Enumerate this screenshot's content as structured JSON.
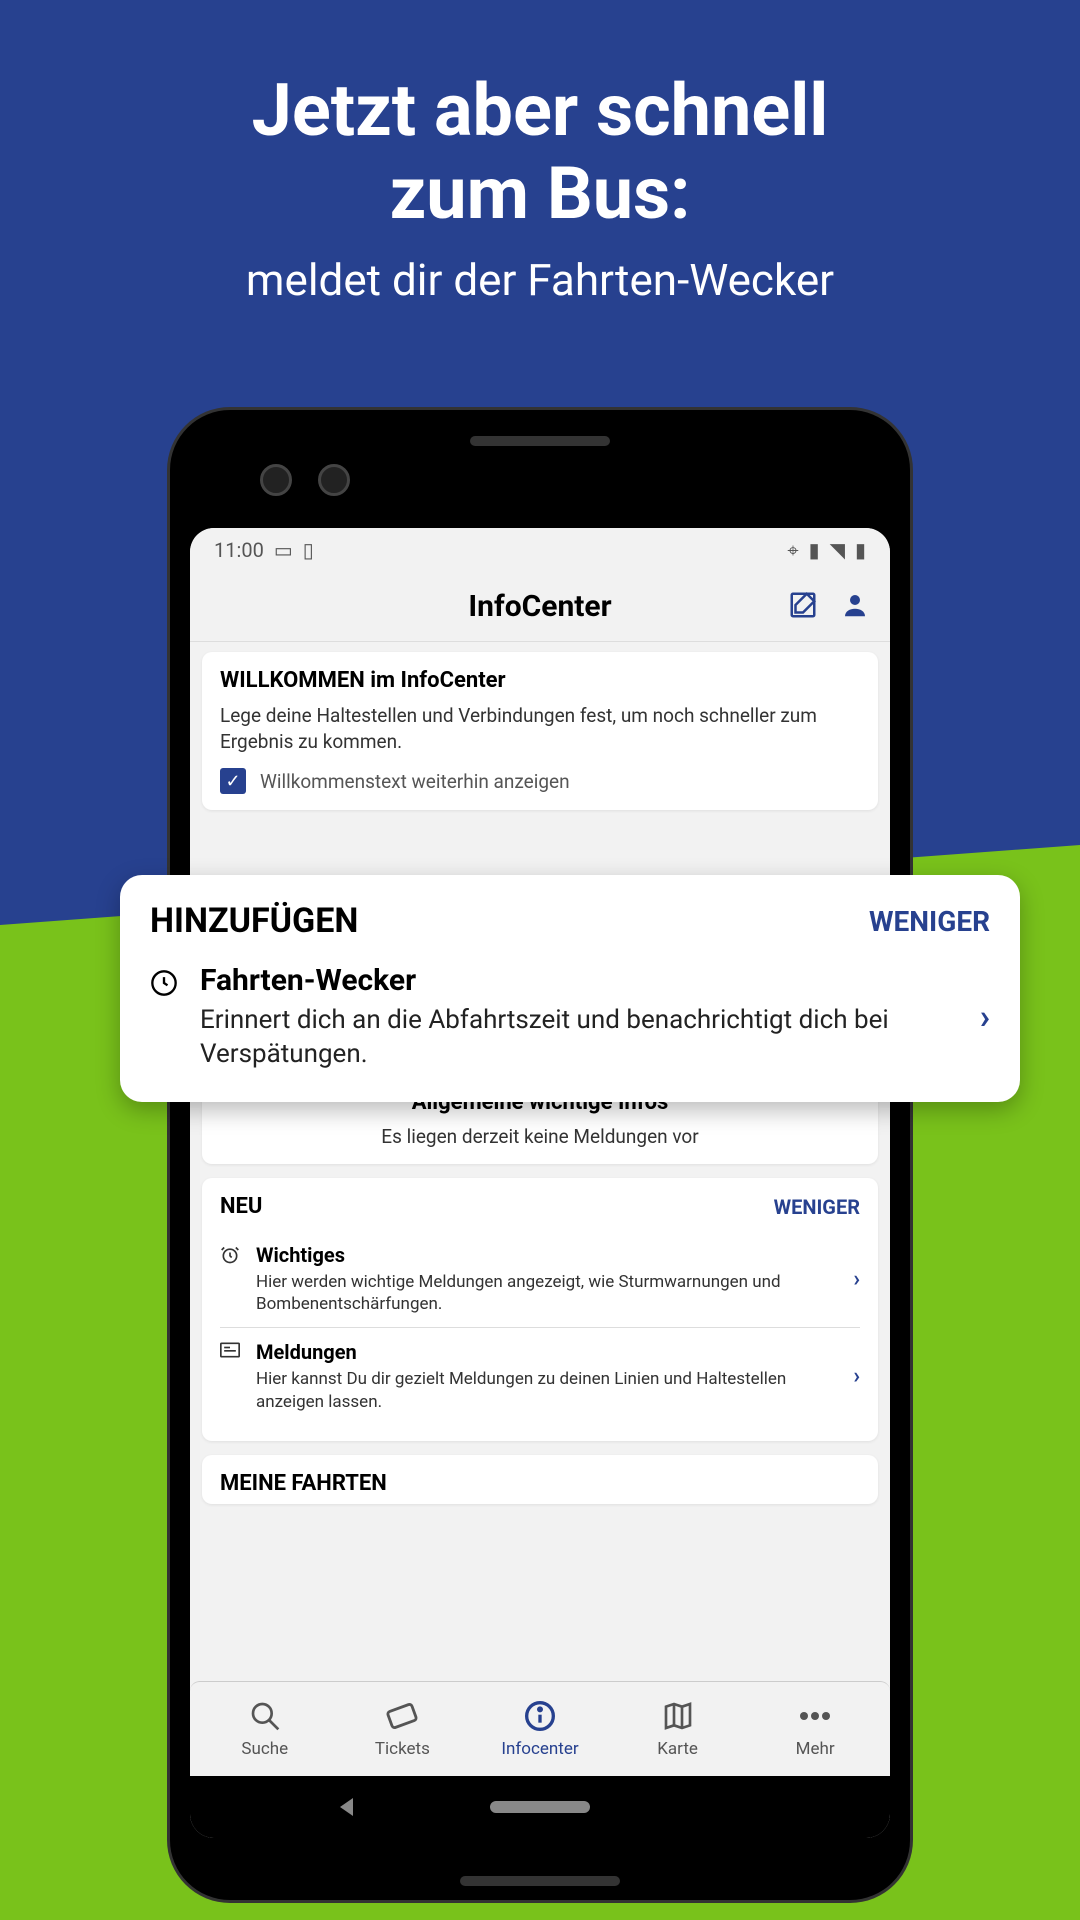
{
  "promo": {
    "title_line1": "Jetzt aber schnell",
    "title_line2": "zum Bus:",
    "subtitle": "meldet dir der Fahrten-Wecker"
  },
  "status": {
    "time": "11:00"
  },
  "header": {
    "title": "InfoCenter"
  },
  "welcome": {
    "title": "WILLKOMMEN im InfoCenter",
    "text": "Lege deine Haltestellen und Verbindungen fest, um noch schneller zum Ergebnis zu kommen.",
    "checkbox_label": "Willkommenstext weiterhin anzeigen"
  },
  "popup": {
    "title": "HINZUFÜGEN",
    "less": "WENIGER",
    "item_title": "Fahrten-Wecker",
    "item_desc": "Erinnert dich an die Abfahrtszeit und benachrichtigt dich bei Verspätungen."
  },
  "general_info": {
    "title": "Allgemeine wichtige Infos",
    "text": "Es liegen derzeit keine Meldungen vor"
  },
  "neu": {
    "title": "NEU",
    "less": "WENIGER",
    "items": [
      {
        "title": "Wichtiges",
        "desc": "Hier werden wichtige Meldungen angezeigt, wie Sturmwarnungen und Bombenentschärfungen."
      },
      {
        "title": "Meldungen",
        "desc": "Hier kannst Du dir gezielt Meldungen zu deinen Linien und Haltestellen anzeigen lassen."
      }
    ]
  },
  "my_trips": {
    "title": "MEINE FAHRTEN"
  },
  "nav": {
    "search": "Suche",
    "tickets": "Tickets",
    "infocenter": "Infocenter",
    "map": "Karte",
    "more": "Mehr"
  }
}
